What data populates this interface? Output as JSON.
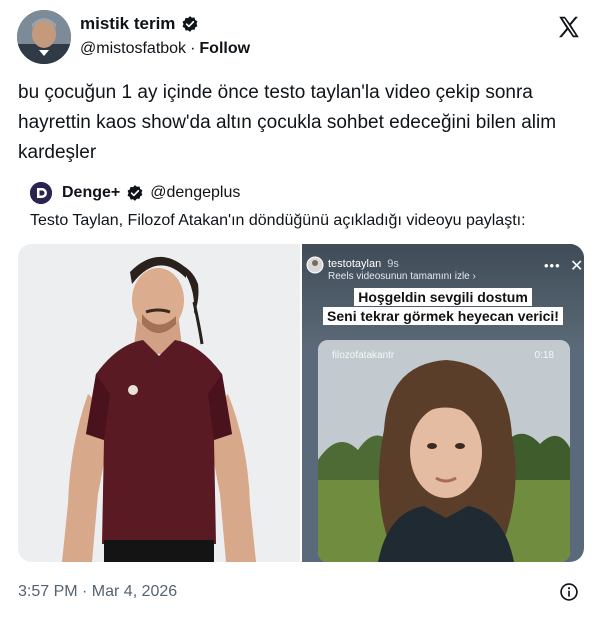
{
  "author": {
    "display_name": "mistik terim",
    "handle": "@mistosfatbok",
    "separator": "·",
    "follow_label": "Follow",
    "verified_icon": "verified-badge-icon",
    "brand_icon": "x-logo-icon"
  },
  "tweet": {
    "text": "bu çocuğun 1 ay içinde önce testo taylan'la video çekip sonra hayrettin kaos show'da altın çocukla sohbet edeceğini bilen alim kardeşler"
  },
  "quote": {
    "display_name": "Denge+",
    "handle": "@dengeplus",
    "text": "Testo Taylan, Filozof Atakan'ın döndüğünü açıkladığı videoyu paylaştı:",
    "story": {
      "username": "testotaylan",
      "time_ago": "9s",
      "subtitle": "Reels videosunun tamamını izle ›",
      "more": "•••",
      "close": "✕",
      "caption_line1": "Hoşgeldin sevgili dostum",
      "caption_line2": "Seni tekrar görmek heyecan verici!",
      "video_username": "filozofatakantr",
      "video_time": "0:18"
    }
  },
  "footer": {
    "timestamp": "3:57 PM · Mar 4, 2026",
    "info_icon": "info-icon"
  },
  "colors": {
    "text": "#0f1419",
    "secondary": "#536471",
    "shirt": "#5a1a24"
  }
}
